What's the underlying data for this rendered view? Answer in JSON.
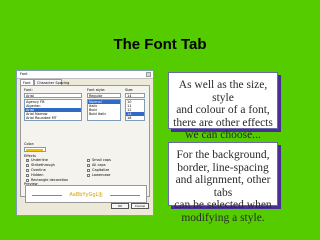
{
  "slide": {
    "title": "The Font Tab"
  },
  "dialog": {
    "title": "Font",
    "tabs": [
      "Font",
      "Character Spacing"
    ],
    "labels": {
      "font": "Font:",
      "font_style": "Font style:",
      "size": "Size:",
      "color": "Color:",
      "effects": "Effects",
      "preview": "Preview"
    },
    "font_value": "Arial",
    "font_list": [
      "Agency FB",
      "Algerian",
      "Arial",
      "Arial Narrow",
      "Arial Rounded MT"
    ],
    "style_value": "Regular",
    "style_list": [
      "Normal",
      "Italic",
      "Bold",
      "Bold Italic"
    ],
    "size_value": "14",
    "size_list": [
      "10",
      "11",
      "12",
      "14",
      "16"
    ],
    "effects_left": [
      "Underline",
      "Strikethrough",
      "Overline",
      "Hidden",
      "Rectangle decoration"
    ],
    "effects_right": [
      "Small caps",
      "All caps",
      "Capitalize",
      "Lowercase"
    ],
    "preview_text": "AaBbYyGgLlJj",
    "buttons": [
      "OK",
      "Cancel"
    ],
    "color_swatch": "#f2c000"
  },
  "callouts": [
    {
      "lines": [
        "As well as the size, style",
        "and colour of a font,",
        "there are other effects",
        "we can choose..."
      ]
    },
    {
      "lines": [
        "For the background,",
        "border, line-spacing",
        "and alignment, other tabs",
        "can be selected when",
        "modifying a style."
      ]
    }
  ],
  "colors": {
    "background": "#55cc00",
    "callout_shadow": "#4a2d97"
  }
}
